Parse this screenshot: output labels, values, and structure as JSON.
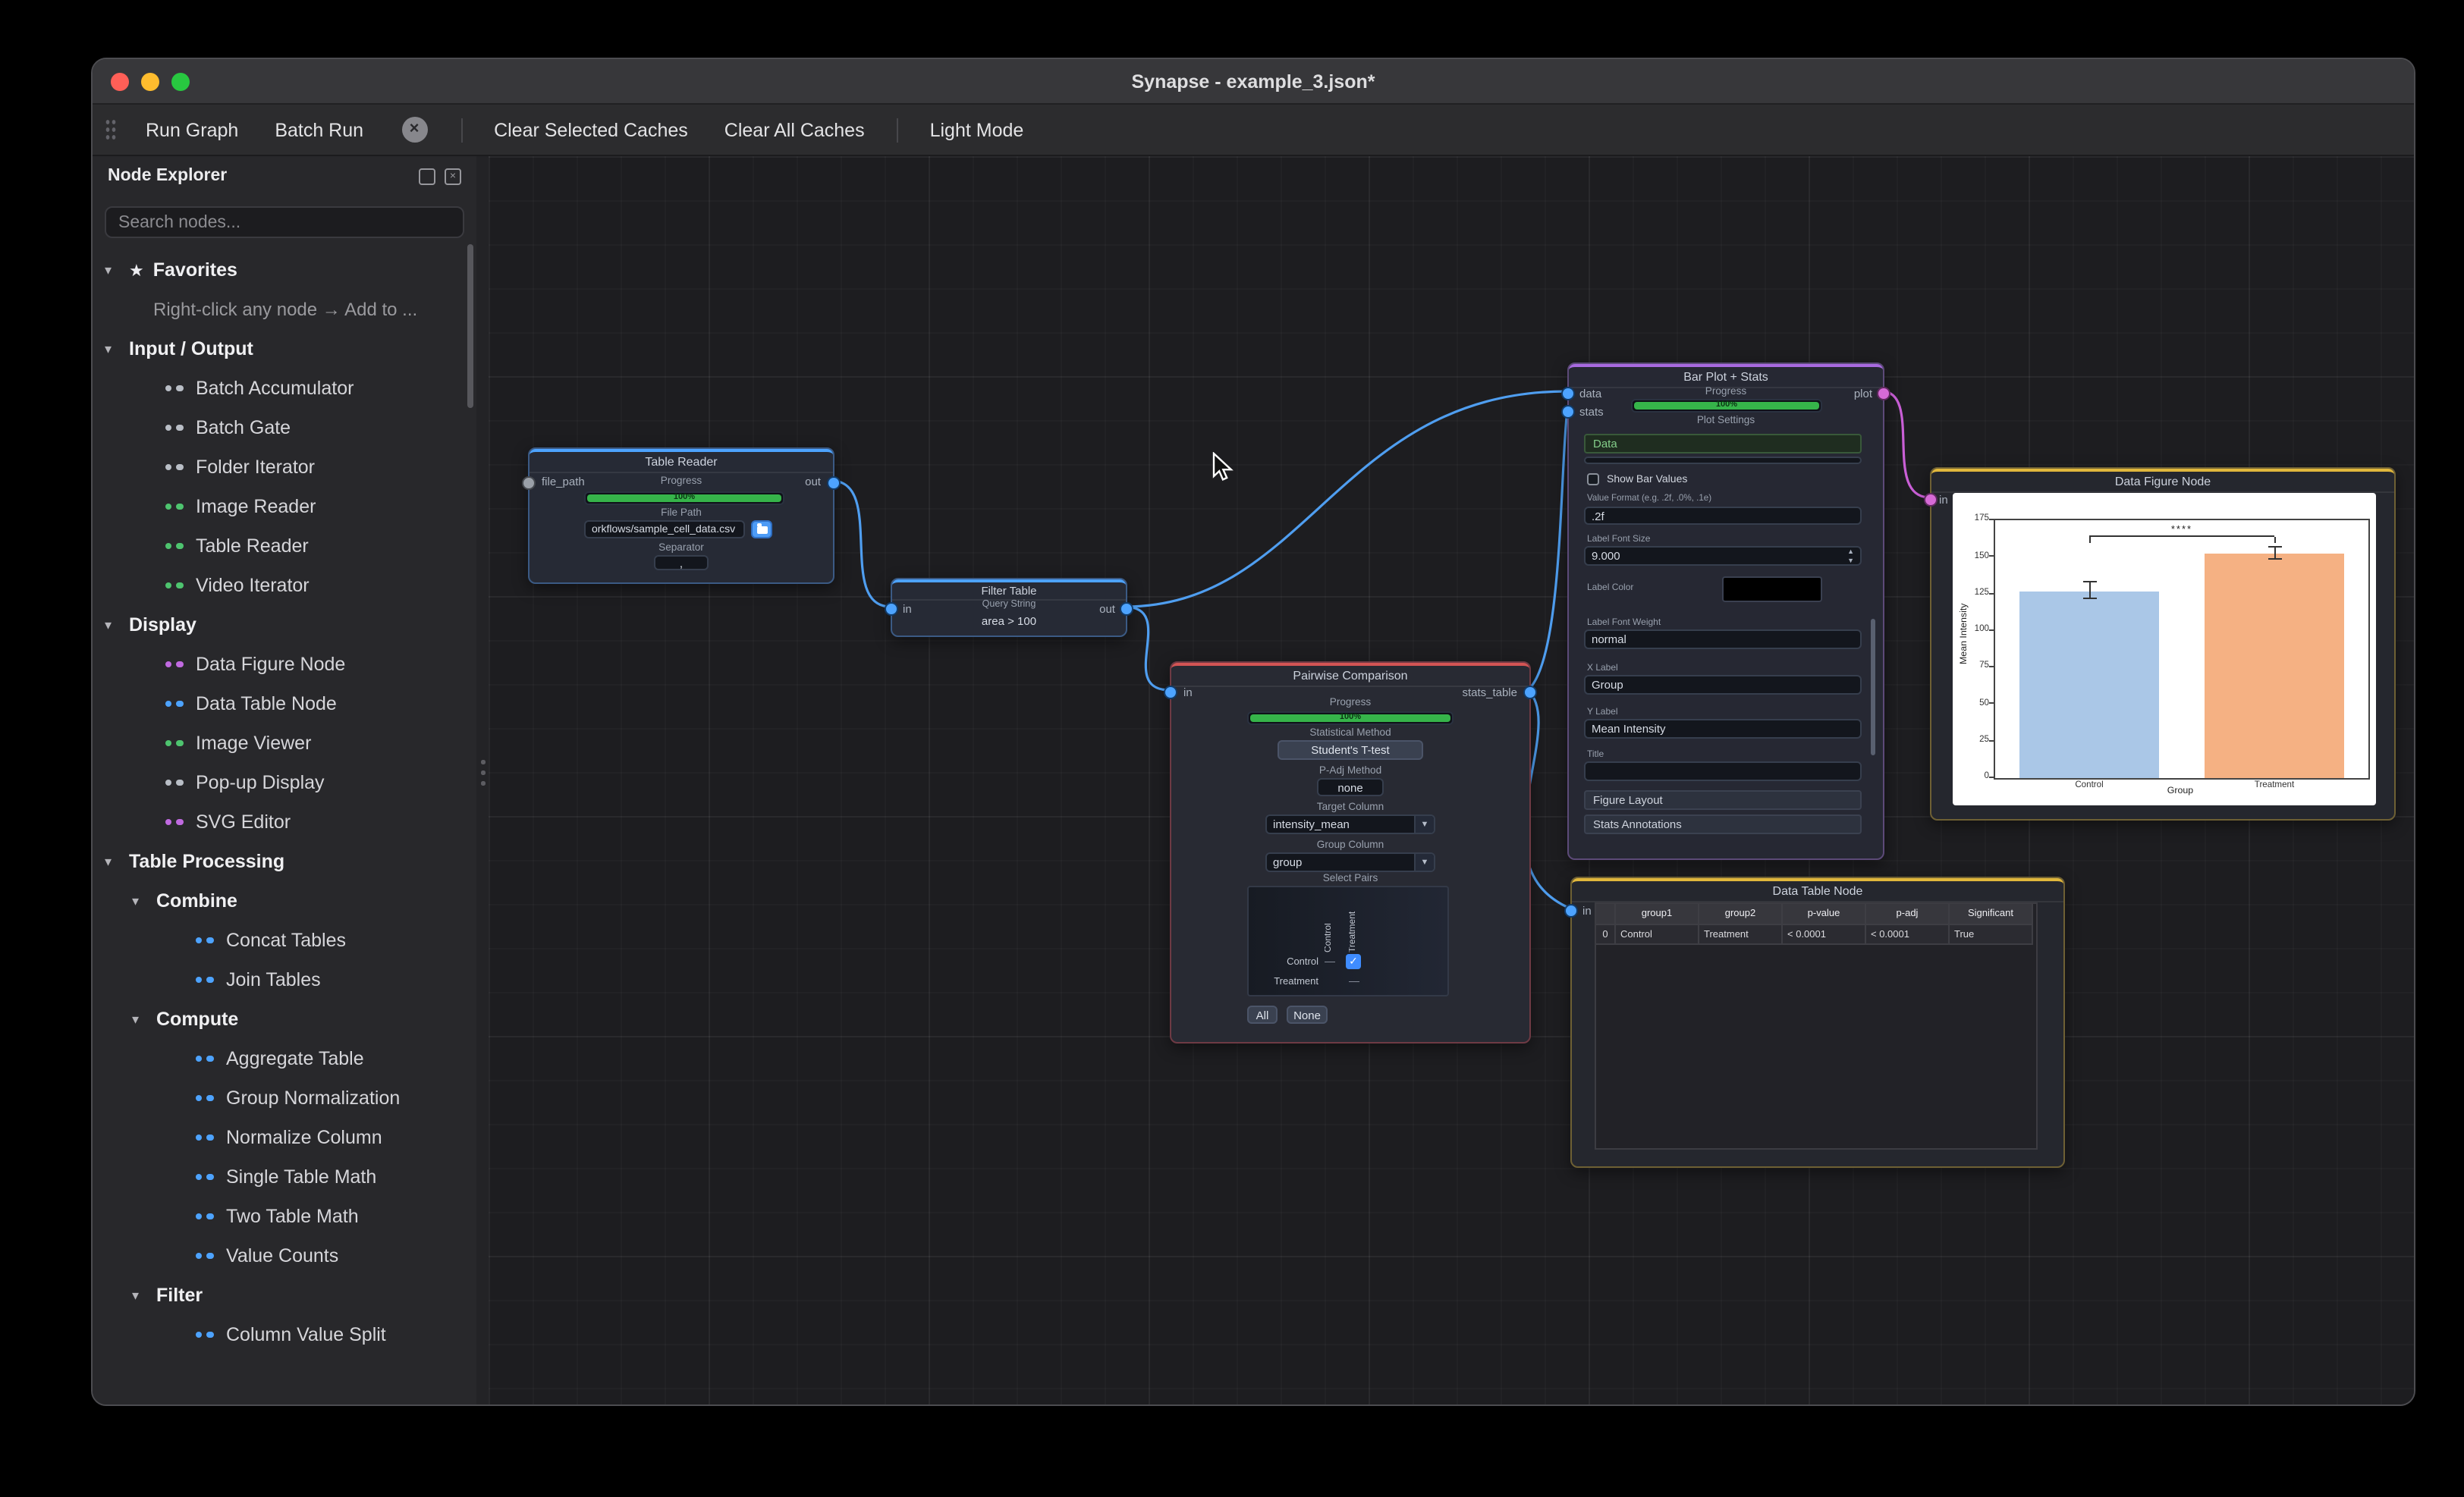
{
  "window": {
    "title": "Synapse - example_3.json*"
  },
  "toolbar": {
    "run_graph": "Run Graph",
    "batch_run": "Batch Run",
    "clear_selected": "Clear Selected Caches",
    "clear_all": "Clear All Caches",
    "light_mode": "Light Mode"
  },
  "sidebar": {
    "title": "Node Explorer",
    "search_placeholder": "Search nodes...",
    "tree": [
      {
        "type": "category",
        "level": 0,
        "star": true,
        "label": "Favorites"
      },
      {
        "type": "hint",
        "label": "Right-click any node → Add to ..."
      },
      {
        "type": "category",
        "level": 0,
        "label": "Input / Output"
      },
      {
        "type": "item",
        "level": 1,
        "label": "Batch Accumulator",
        "color": "#b9bec6"
      },
      {
        "type": "item",
        "level": 1,
        "label": "Batch Gate",
        "color": "#b9bec6"
      },
      {
        "type": "item",
        "level": 1,
        "label": "Folder Iterator",
        "color": "#b9bec6"
      },
      {
        "type": "item",
        "level": 1,
        "label": "Image Reader",
        "color": "#4ec46f"
      },
      {
        "type": "item",
        "level": 1,
        "label": "Table Reader",
        "color": "#4ec46f"
      },
      {
        "type": "item",
        "level": 1,
        "label": "Video Iterator",
        "color": "#4ec46f"
      },
      {
        "type": "category",
        "level": 0,
        "label": "Display"
      },
      {
        "type": "item",
        "level": 1,
        "label": "Data Figure Node",
        "color": "#c06ae0"
      },
      {
        "type": "item",
        "level": 1,
        "label": "Data Table Node",
        "color": "#4da3ff"
      },
      {
        "type": "item",
        "level": 1,
        "label": "Image Viewer",
        "color": "#4ec46f"
      },
      {
        "type": "item",
        "level": 1,
        "label": "Pop-up Display",
        "color": "#b9bec6"
      },
      {
        "type": "item",
        "level": 1,
        "label": "SVG Editor",
        "color": "#c06ae0"
      },
      {
        "type": "category",
        "level": 0,
        "label": "Table Processing"
      },
      {
        "type": "category",
        "level": 1,
        "label": "Combine"
      },
      {
        "type": "item",
        "level": 2,
        "label": "Concat Tables",
        "color": "#4da3ff"
      },
      {
        "type": "item",
        "level": 2,
        "label": "Join Tables",
        "color": "#4da3ff"
      },
      {
        "type": "category",
        "level": 1,
        "label": "Compute"
      },
      {
        "type": "item",
        "level": 2,
        "label": "Aggregate Table",
        "color": "#4da3ff"
      },
      {
        "type": "item",
        "level": 2,
        "label": "Group Normalization",
        "color": "#4da3ff"
      },
      {
        "type": "item",
        "level": 2,
        "label": "Normalize Column",
        "color": "#4da3ff"
      },
      {
        "type": "item",
        "level": 2,
        "label": "Single Table Math",
        "color": "#4da3ff"
      },
      {
        "type": "item",
        "level": 2,
        "label": "Two Table Math",
        "color": "#4da3ff"
      },
      {
        "type": "item",
        "level": 2,
        "label": "Value Counts",
        "color": "#4da3ff"
      },
      {
        "type": "category",
        "level": 1,
        "label": "Filter"
      },
      {
        "type": "item",
        "level": 2,
        "label": "Column Value Split",
        "color": "#4da3ff"
      }
    ]
  },
  "canvas": {
    "nodes": {
      "table_reader": {
        "title": "Table Reader",
        "in_label": "file_path",
        "out_label": "out",
        "progress_label": "Progress",
        "progress_value": "100%",
        "file_path_label": "File Path",
        "file_path_value": "orkflows/sample_cell_data.csv",
        "separator_label": "Separator",
        "separator_value": ","
      },
      "filter_table": {
        "title": "Filter Table",
        "in_label": "in",
        "out_label": "out",
        "query_label": "Query String",
        "query_value": "area > 100"
      },
      "pairwise": {
        "title": "Pairwise Comparison",
        "in_label": "in",
        "out_label": "stats_table",
        "progress_label": "Progress",
        "progress_value": "100%",
        "stat_method_label": "Statistical Method",
        "stat_method_value": "Student's T-test",
        "padj_label": "P-Adj Method",
        "padj_value": "none",
        "target_label": "Target Column",
        "target_value": "intensity_mean",
        "group_label": "Group Column",
        "group_value": "group",
        "pairs_label": "Select Pairs",
        "matrix": {
          "rows": [
            "Control",
            "Treatment"
          ],
          "cols": [
            "Control",
            "Treatment"
          ]
        },
        "all_btn": "All",
        "none_btn": "None"
      },
      "bar_plot": {
        "title": "Bar Plot + Stats",
        "in1_label": "data",
        "in2_label": "stats",
        "out_label": "plot",
        "progress_label": "Progress",
        "progress_value": "100%",
        "settings_label": "Plot Settings",
        "section_data": "Data",
        "show_bar_values": "Show Bar Values",
        "value_format_label": "Value Format  (e.g. .2f, .0%, .1e)",
        "value_format": ".2f",
        "font_size_label": "Label Font Size",
        "font_size": "9.000",
        "label_color_label": "Label Color",
        "font_weight_label": "Label Font Weight",
        "font_weight": "normal",
        "x_label_label": "X Label",
        "x_label": "Group",
        "y_label_label": "Y Label",
        "y_label": "Mean Intensity",
        "title_label": "Title",
        "title_value": "",
        "section_figure_layout": "Figure Layout",
        "section_stats_annotations": "Stats Annotations"
      },
      "data_figure": {
        "title": "Data Figure Node",
        "in_label": "in"
      },
      "data_table": {
        "title": "Data Table Node",
        "in_label": "in",
        "columns": [
          "",
          "group1",
          "group2",
          "p-value",
          "p-adj",
          "Significant"
        ],
        "rows": [
          [
            "0",
            "Control",
            "Treatment",
            "< 0.0001",
            "< 0.0001",
            "True"
          ]
        ]
      }
    }
  },
  "chart_data": {
    "type": "bar",
    "categories": [
      "Control",
      "Treatment"
    ],
    "values": [
      127,
      152
    ],
    "errors": [
      6,
      4
    ],
    "title": "",
    "xlabel": "Group",
    "ylabel": "Mean Intensity",
    "ylim": [
      0,
      175
    ],
    "yticks": [
      0,
      25,
      50,
      75,
      100,
      125,
      150,
      175
    ],
    "annotation": "****",
    "annotation_y": 164,
    "bar_colors": [
      "#aac7e7",
      "#f5b183"
    ],
    "legend_position": "none",
    "grid": false
  }
}
